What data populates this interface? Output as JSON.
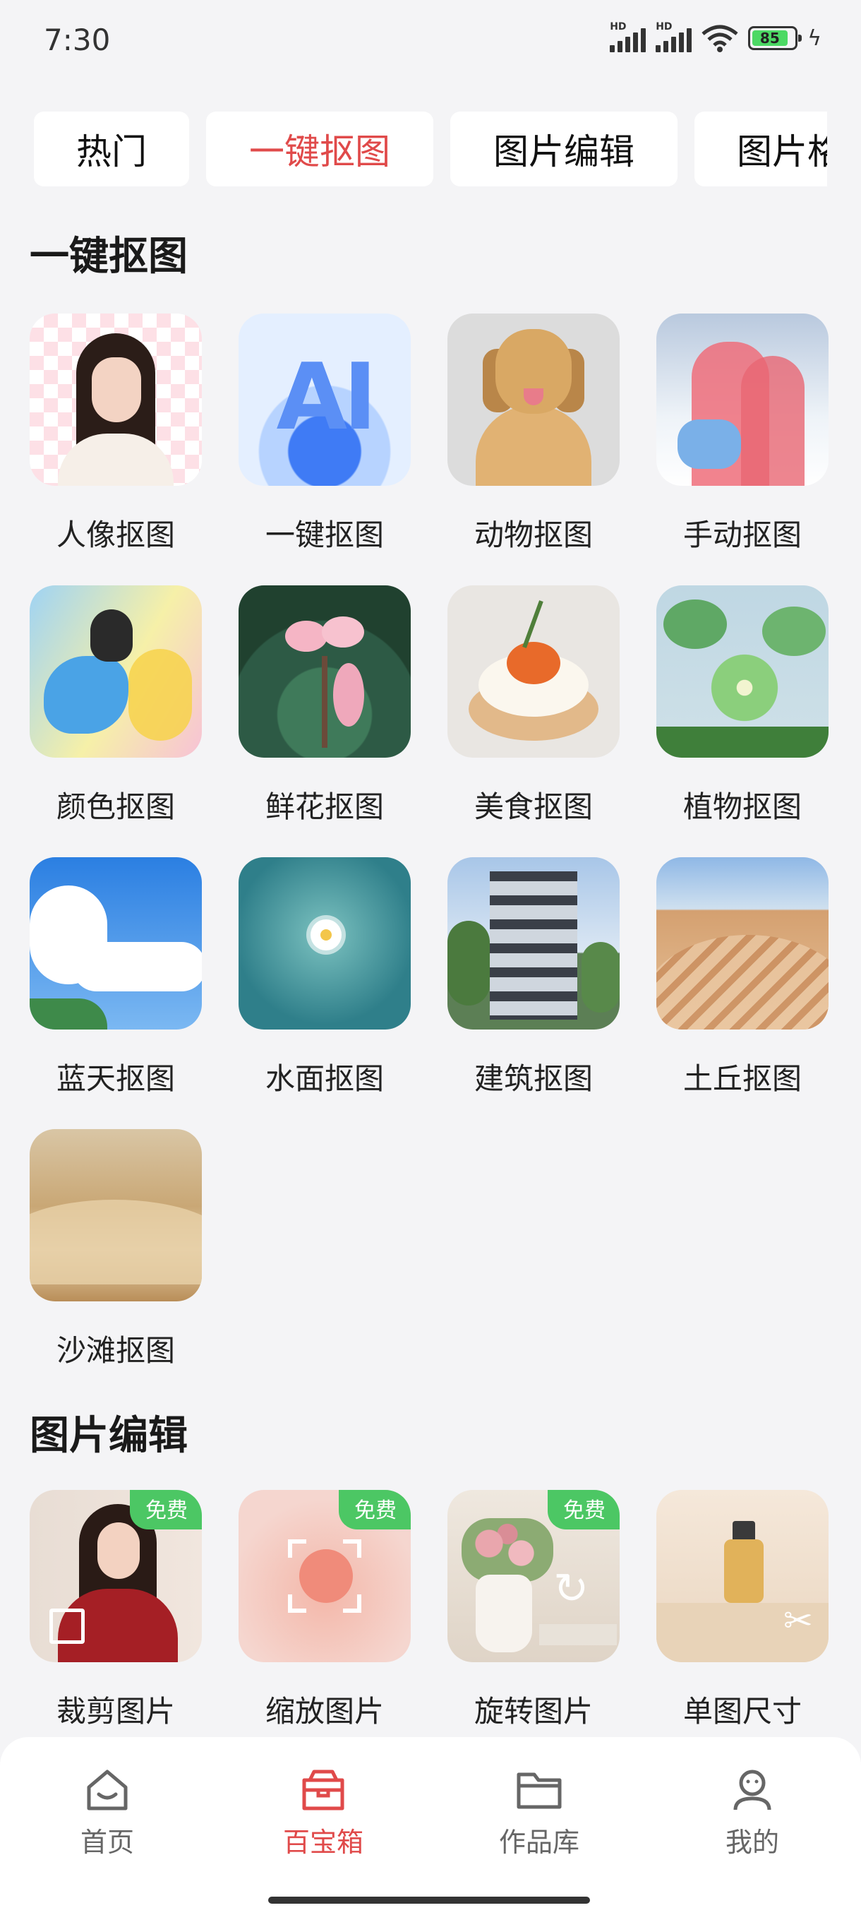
{
  "status_bar": {
    "time": "7:30",
    "hd1": "HD",
    "hd2": "HD",
    "battery": "85"
  },
  "tabs": [
    {
      "label": "热门",
      "active": false
    },
    {
      "label": "一键抠图",
      "active": true
    },
    {
      "label": "图片编辑",
      "active": false
    },
    {
      "label": "图片格",
      "active": false
    }
  ],
  "sections": {
    "cutout": {
      "title": "一键抠图",
      "items": [
        {
          "label": "人像抠图",
          "icon": "portrait-image"
        },
        {
          "label": "一键抠图",
          "icon": "ai-image"
        },
        {
          "label": "动物抠图",
          "icon": "dog-image"
        },
        {
          "label": "手动抠图",
          "icon": "couple-image"
        },
        {
          "label": "颜色抠图",
          "icon": "color-splash-image"
        },
        {
          "label": "鲜花抠图",
          "icon": "flower-image"
        },
        {
          "label": "美食抠图",
          "icon": "food-image"
        },
        {
          "label": "植物抠图",
          "icon": "plant-image"
        },
        {
          "label": "蓝天抠图",
          "icon": "sky-image"
        },
        {
          "label": "水面抠图",
          "icon": "water-image"
        },
        {
          "label": "建筑抠图",
          "icon": "building-image"
        },
        {
          "label": "土丘抠图",
          "icon": "hill-image"
        },
        {
          "label": "沙滩抠图",
          "icon": "sand-image"
        }
      ]
    },
    "edit": {
      "title": "图片编辑",
      "items": [
        {
          "label": "裁剪图片",
          "badge": "免费",
          "icon": "crop-icon"
        },
        {
          "label": "缩放图片",
          "badge": "免费",
          "icon": "zoom-icon"
        },
        {
          "label": "旋转图片",
          "badge": "免费",
          "icon": "rotate-icon"
        },
        {
          "label": "单图尺寸",
          "badge": "",
          "icon": "resize-icon"
        }
      ]
    }
  },
  "bottom_nav": [
    {
      "label": "首页",
      "icon": "home-icon",
      "active": false
    },
    {
      "label": "百宝箱",
      "icon": "toolbox-icon",
      "active": true
    },
    {
      "label": "作品库",
      "icon": "folder-icon",
      "active": false
    },
    {
      "label": "我的",
      "icon": "profile-icon",
      "active": false
    }
  ],
  "colors": {
    "accent": "#e04a4a",
    "badge": "#4cc764",
    "background": "#f4f4f6"
  }
}
